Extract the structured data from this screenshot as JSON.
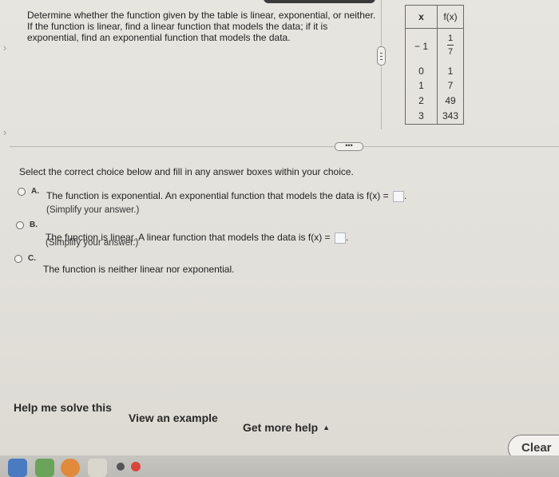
{
  "question": {
    "lines": [
      "Determine whether the function given by the table is linear, exponential, or neither.",
      "If the function is linear, find a linear function that models the data; if it is",
      "exponential, find an exponential function that models the data."
    ]
  },
  "table": {
    "header_x": "x",
    "header_f": "f(x)",
    "rows": [
      {
        "x": "− 1",
        "f_num": "1",
        "f_den": "7"
      },
      {
        "x": "0",
        "f": "1"
      },
      {
        "x": "1",
        "f": "7"
      },
      {
        "x": "2",
        "f": "49"
      },
      {
        "x": "3",
        "f": "343"
      }
    ]
  },
  "instruction": "Select the correct choice below and fill in any answer boxes within your choice.",
  "choices": [
    {
      "letter": "A.",
      "text": "The function is exponential. An exponential function that models the data is f(x) =",
      "sub": "(Simplify your answer.)"
    },
    {
      "letter": "B.",
      "text": "The function is linear. A linear function that models the data is f(x) =",
      "sub": "(Simplify your answer.)"
    },
    {
      "letter": "C.",
      "text": "The function is neither linear nor exponential."
    }
  ],
  "footer": {
    "help_solve": "Help me solve this",
    "view_example": "View an example",
    "get_more_help": "Get more help",
    "get_more_help_caret": "▲",
    "clear": "Clear"
  },
  "handles": {
    "horizontal": "•••"
  },
  "colors": {
    "background": "#e4e2dc",
    "answer_box_border": "#aeb4bd",
    "dock": "#c1bfba"
  }
}
